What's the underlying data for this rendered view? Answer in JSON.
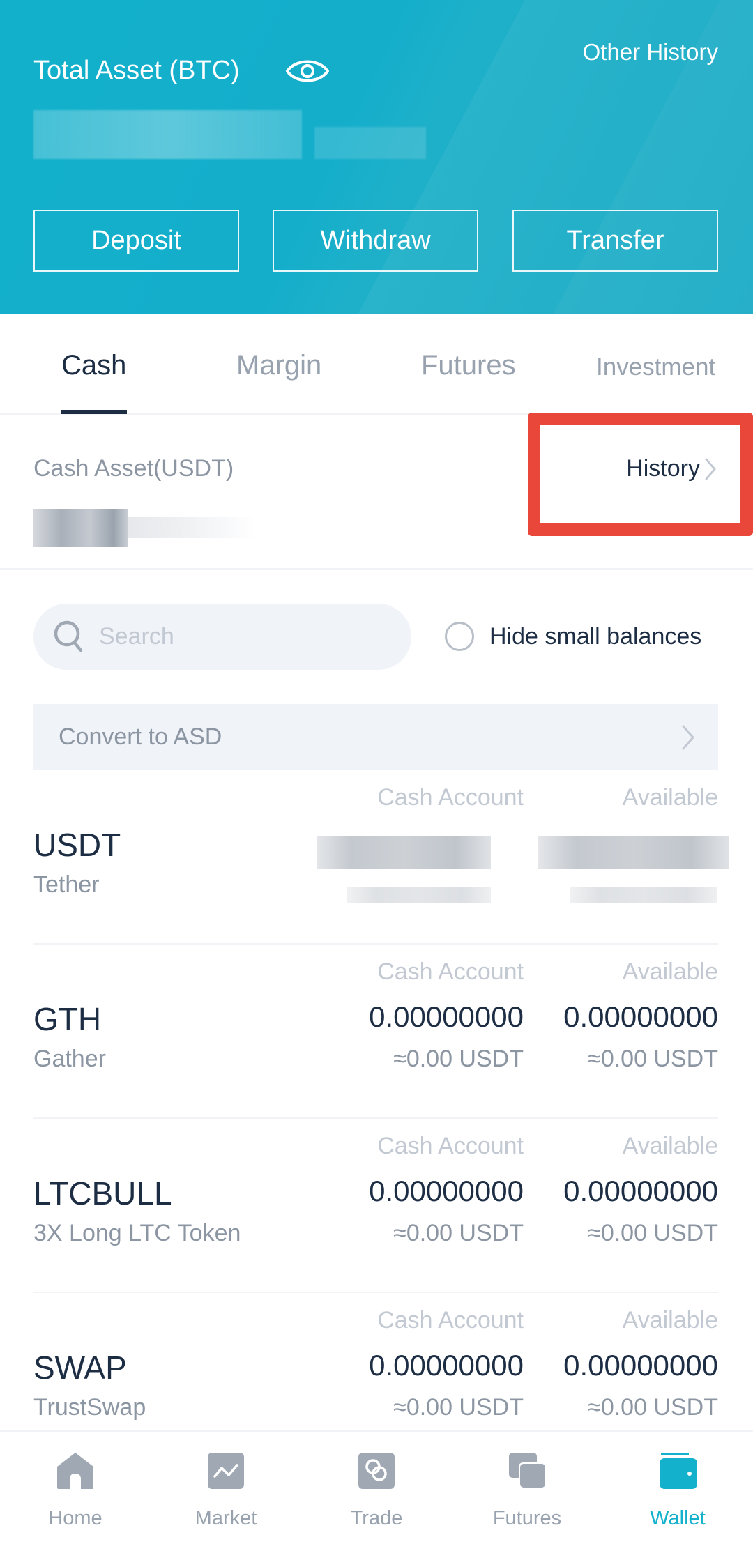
{
  "header": {
    "other_history": "Other History",
    "total_asset_label": "Total Asset (BTC)",
    "eye_icon": "eye-icon",
    "total_asset_value": "[redacted]",
    "buttons": {
      "deposit": "Deposit",
      "withdraw": "Withdraw",
      "transfer": "Transfer"
    },
    "colors": {
      "background": "#14b1cc",
      "text": "#ffffff"
    }
  },
  "tabs": [
    {
      "label": "Cash",
      "active": true
    },
    {
      "label": "Margin",
      "active": false
    },
    {
      "label": "Futures",
      "active": false
    },
    {
      "label": "Investment",
      "active": false
    }
  ],
  "cash_asset": {
    "label": "Cash Asset(USDT)",
    "value": "[redacted]",
    "history_link": "History",
    "highlight_color": "#e8473a"
  },
  "filters": {
    "search_placeholder": "Search",
    "search_value": "",
    "hide_small_balances_label": "Hide small balances",
    "hide_small_balances_checked": false
  },
  "convert_row": {
    "label": "Convert to ASD"
  },
  "columns": {
    "cash_account": "Cash Account",
    "available": "Available"
  },
  "assets": [
    {
      "symbol": "USDT",
      "name": "Tether",
      "cash_account": "[redacted]",
      "cash_account_usdt": "[redacted]",
      "available": "[redacted]",
      "available_usdt": "[redacted]",
      "redacted": true
    },
    {
      "symbol": "GTH",
      "name": "Gather",
      "cash_account": "0.00000000",
      "cash_account_usdt": "≈0.00 USDT",
      "available": "0.00000000",
      "available_usdt": "≈0.00 USDT",
      "redacted": false
    },
    {
      "symbol": "LTCBULL",
      "name": "3X Long LTC Token",
      "cash_account": "0.00000000",
      "cash_account_usdt": "≈0.00 USDT",
      "available": "0.00000000",
      "available_usdt": "≈0.00 USDT",
      "redacted": false
    },
    {
      "symbol": "SWAP",
      "name": "TrustSwap",
      "cash_account": "0.00000000",
      "cash_account_usdt": "≈0.00 USDT",
      "available": "0.00000000",
      "available_usdt": "≈0.00 USDT",
      "redacted": false
    }
  ],
  "bottom_nav": [
    {
      "label": "Home",
      "icon": "home-icon",
      "active": false
    },
    {
      "label": "Market",
      "icon": "market-chart-icon",
      "active": false
    },
    {
      "label": "Trade",
      "icon": "trade-rings-icon",
      "active": false
    },
    {
      "label": "Futures",
      "icon": "futures-cards-icon",
      "active": false
    },
    {
      "label": "Wallet",
      "icon": "wallet-icon",
      "active": true
    }
  ],
  "colors": {
    "accent": "#14b1cc",
    "text_primary": "#1c2d44",
    "text_secondary": "#8c96a3",
    "text_muted": "#c3c9d2",
    "icon_inactive": "#a0a8b3",
    "surface": "#f0f3f8"
  }
}
